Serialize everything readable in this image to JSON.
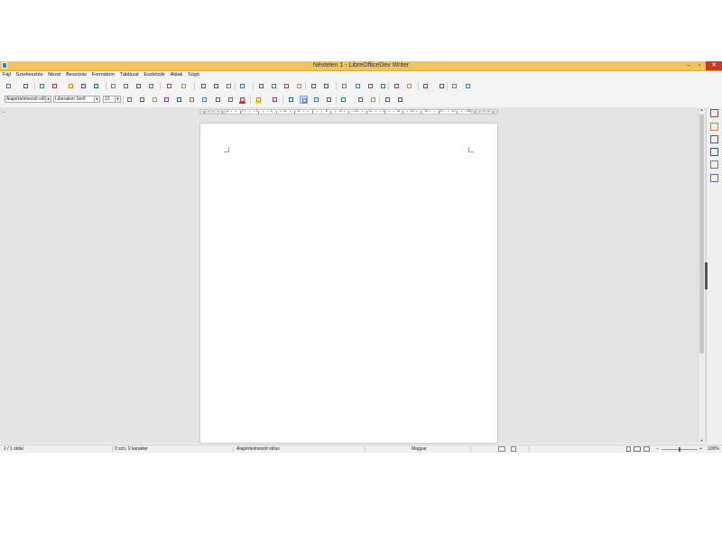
{
  "window": {
    "title": "Névtelen 1 - LibreOfficeDev Writer",
    "minimize_glyph": "–",
    "maximize_glyph": "▫",
    "close_glyph": "✕"
  },
  "menu": [
    "Fájl",
    "Szerkesztés",
    "Nézet",
    "Beszúrás",
    "Formátum",
    "Táblázat",
    "Eszközök",
    "Ablak",
    "Súgó"
  ],
  "formatting": {
    "paragraph_style": "Alapértelmezett stílus",
    "font_name": "Liberation Serif",
    "font_size": "12"
  },
  "ruler": {
    "corner_glyph": "⌙",
    "numbers": [
      "1",
      "2",
      "3",
      "4",
      "5",
      "6",
      "7",
      "8",
      "9",
      "10",
      "11",
      "12",
      "13",
      "14",
      "15",
      "16",
      "17",
      "18"
    ]
  },
  "scrollbar": {
    "up_glyph": "▲",
    "down_glyph": "▼"
  },
  "statusbar": {
    "page": "1 / 1 oldal",
    "words": "0 szó, 0 karakter",
    "style": "Alapértelmezett stílus",
    "language": "Magyar",
    "zoom": "100%",
    "zoom_minus": "–",
    "zoom_plus": "+"
  },
  "icons": {
    "toolbar1": [
      "new-document-icon",
      "open-icon",
      "save-icon",
      "email-icon",
      "edit-mode-icon",
      "export-pdf-icon",
      "print-icon",
      "print-preview-icon",
      "cut-icon",
      "copy-icon",
      "paste-icon",
      "clone-formatting-icon",
      "undo-icon",
      "redo-icon",
      "find-replace-icon",
      "spellcheck-icon",
      "formatting-marks-icon",
      "insert-table-icon",
      "insert-image-icon",
      "insert-chart-icon",
      "insert-textbox-icon",
      "insert-page-break-icon",
      "insert-field-icon",
      "special-character-icon",
      "hyperlink-icon",
      "footnote-icon",
      "endnote-icon",
      "bookmark-icon",
      "cross-reference-icon",
      "comment-icon",
      "track-changes-icon",
      "line-icon",
      "basic-shapes-icon",
      "draw-functions-icon"
    ],
    "toolbar2": [
      "clear-formatting-icon",
      "bold-icon",
      "italic-icon",
      "underline-icon",
      "strikethrough-icon",
      "superscript-icon",
      "subscript-icon",
      "shadow-icon",
      "outline-icon",
      "font-color-icon",
      "highlight-icon",
      "bullets-icon",
      "numbering-icon",
      "align-left-icon",
      "align-center-icon",
      "align-right-icon",
      "justify-icon",
      "line-spacing-icon",
      "paragraph-spacing-up-icon",
      "paragraph-spacing-down-icon",
      "indent-increase-icon",
      "indent-decrease-icon"
    ],
    "sidebar": [
      "sidebar-settings-icon",
      "properties-icon",
      "styles-icon",
      "gallery-icon",
      "navigator-icon",
      "page-icon"
    ]
  },
  "colors": {
    "titlebar": "#f0c463",
    "close": "#c7392b",
    "workspace": "#e4e4e4",
    "active": "#c8daf2",
    "font_color": "#c0392b",
    "highlight": "#f4e21a"
  }
}
